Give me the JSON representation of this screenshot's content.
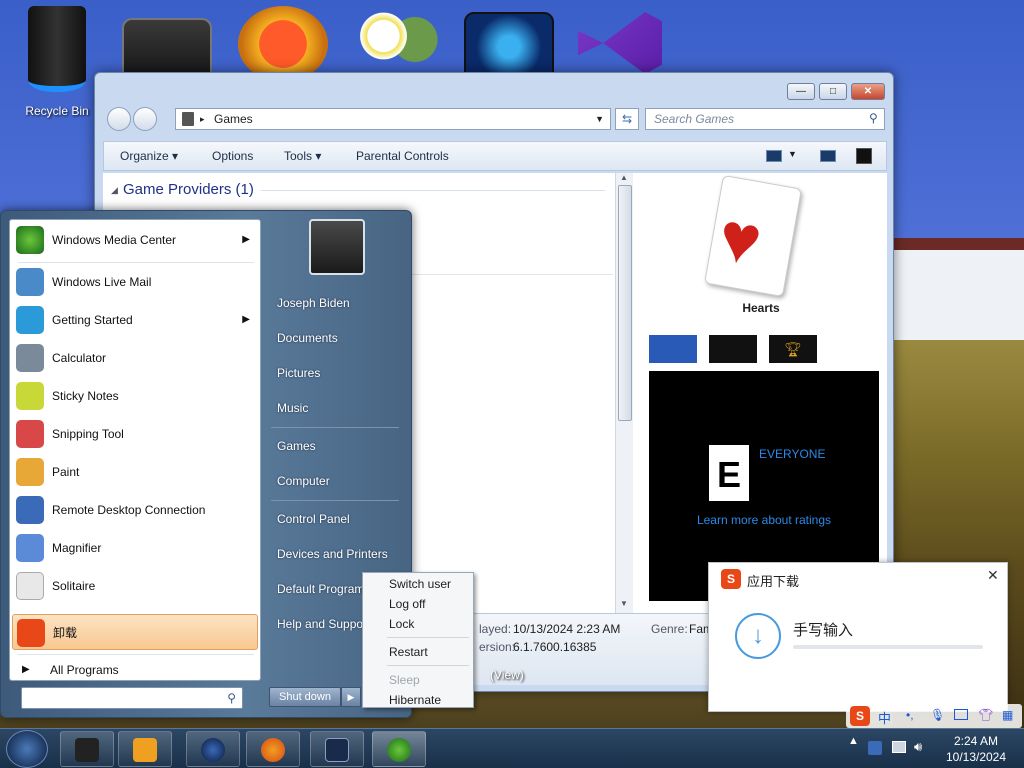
{
  "desktop": {
    "recycle_bin_label": "Recycle Bin"
  },
  "explorer": {
    "address_text": "Games",
    "search_placeholder": "Search Games",
    "commands": [
      "Organize",
      "Options",
      "Tools",
      "Parental Controls"
    ],
    "group_header": "Game Providers (1)",
    "preview_title": "Hearts",
    "rating_label": "EVERYONE",
    "ratings_link": "Learn more about ratings",
    "details": {
      "last_played_label": "layed:",
      "last_played_value": "10/13/2024 2:23 AM",
      "version_label": "ersion:",
      "version_value": "6.1.7600.16385",
      "genre_label": "Genre:",
      "genre_value": "Fam",
      "view_link": "(View)"
    },
    "caption_buttons": {
      "minimize": "—",
      "maximize": "□",
      "close": "✕"
    }
  },
  "start_menu": {
    "programs": [
      {
        "label": "Windows Media Center",
        "has_submenu": true,
        "color": "#3a8a2a"
      },
      {
        "label": "Windows Live Mail",
        "has_submenu": false,
        "color": "#4a8ac8"
      },
      {
        "label": "Getting Started",
        "has_submenu": true,
        "color": "#2a9ad8"
      },
      {
        "label": "Calculator",
        "has_submenu": false,
        "color": "#7a8a9a"
      },
      {
        "label": "Sticky Notes",
        "has_submenu": false,
        "color": "#c8d838"
      },
      {
        "label": "Snipping Tool",
        "has_submenu": false,
        "color": "#d84848"
      },
      {
        "label": "Paint",
        "has_submenu": false,
        "color": "#e8a838"
      },
      {
        "label": "Remote Desktop Connection",
        "has_submenu": false,
        "color": "#3a6ab8"
      },
      {
        "label": "Magnifier",
        "has_submenu": false,
        "color": "#5a8ad8"
      },
      {
        "label": "Solitaire",
        "has_submenu": false,
        "color": "#e8e8e8"
      },
      {
        "label": "卸载",
        "has_submenu": false,
        "color": "#e84818"
      }
    ],
    "all_programs": "All Programs",
    "right_items": [
      "Joseph Biden",
      "Documents",
      "Pictures",
      "Music",
      "Games",
      "Computer",
      "Control Panel",
      "Devices and Printers",
      "Default Programs",
      "Help and Support"
    ],
    "shutdown_label": "Shut down",
    "power_submenu": [
      "Switch user",
      "Log off",
      "Lock",
      "Restart",
      "Sleep",
      "Hibernate"
    ]
  },
  "popup": {
    "title": "应用下载",
    "item_name": "手写输入",
    "close": "✕"
  },
  "taskbar": {
    "clock_time": "2:24 AM",
    "clock_date": "10/13/2024",
    "ime_text": "中"
  }
}
